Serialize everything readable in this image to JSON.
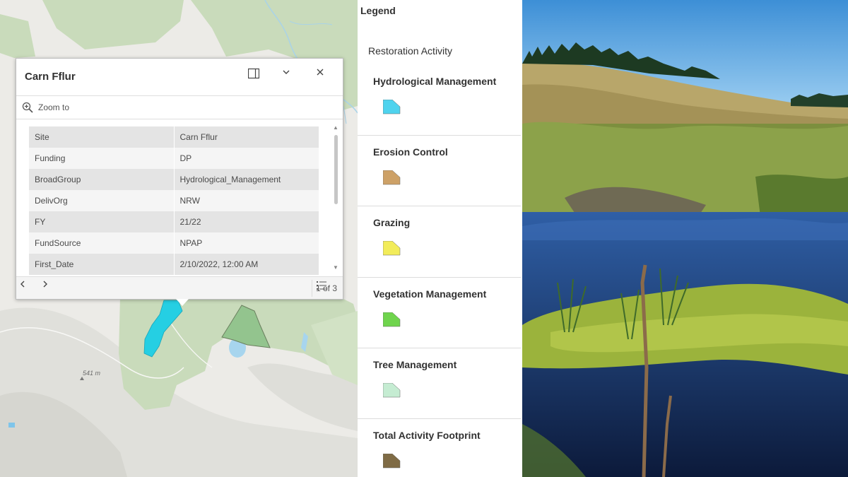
{
  "map": {
    "elevation_label": "541 m"
  },
  "popup": {
    "title": "Carn Fflur",
    "zoom_label": "Zoom to",
    "attributes": [
      {
        "key": "Site",
        "value": "Carn Fflur"
      },
      {
        "key": "Funding",
        "value": "DP"
      },
      {
        "key": "BroadGroup",
        "value": "Hydrological_Management"
      },
      {
        "key": "DelivOrg",
        "value": "NRW"
      },
      {
        "key": "FY",
        "value": "21/22"
      },
      {
        "key": "FundSource",
        "value": "NPAP"
      },
      {
        "key": "First_Date",
        "value": "2/10/2022, 12:00 AM"
      }
    ],
    "pager_text": "1 of 3"
  },
  "legend": {
    "title": "Legend",
    "layer_title": "Restoration Activity",
    "items": [
      {
        "label": "Hydrological Management",
        "color": "#4fd3ee"
      },
      {
        "label": "Erosion Control",
        "color": "#cda167"
      },
      {
        "label": "Grazing",
        "color": "#f2ec5a"
      },
      {
        "label": "Vegetation Management",
        "color": "#6fd44d"
      },
      {
        "label": "Tree Management",
        "color": "#c5ecd2"
      },
      {
        "label": "Total Activity Footprint",
        "color": "#7f6b45"
      }
    ]
  },
  "colors": {
    "map_background": "#ecebe7",
    "forest_green": "#c9dbbb",
    "hydro_cyan": "#25cfe3",
    "vegetation_green": "#93c48e"
  }
}
